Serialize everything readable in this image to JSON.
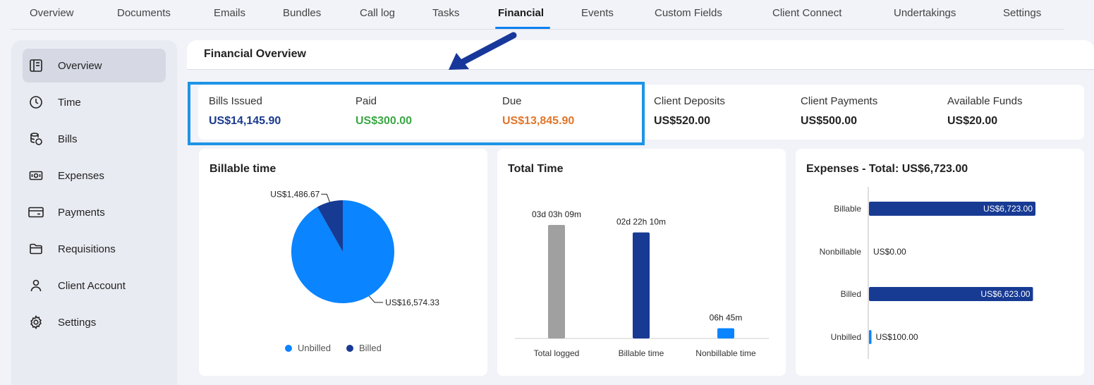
{
  "tabs": [
    {
      "label": "Overview"
    },
    {
      "label": "Documents"
    },
    {
      "label": "Emails"
    },
    {
      "label": "Bundles"
    },
    {
      "label": "Call log"
    },
    {
      "label": "Tasks"
    },
    {
      "label": "Financial",
      "active": true
    },
    {
      "label": "Events"
    },
    {
      "label": "Custom Fields"
    },
    {
      "label": "Client Connect"
    },
    {
      "label": "Undertakings"
    },
    {
      "label": "Settings"
    }
  ],
  "sidebar": {
    "items": [
      {
        "label": "Overview",
        "icon": "book-icon",
        "active": true
      },
      {
        "label": "Time",
        "icon": "clock-icon"
      },
      {
        "label": "Bills",
        "icon": "coins-icon"
      },
      {
        "label": "Expenses",
        "icon": "banknote-icon"
      },
      {
        "label": "Payments",
        "icon": "credit-card-icon"
      },
      {
        "label": "Requisitions",
        "icon": "folder-icon"
      },
      {
        "label": "Client Account",
        "icon": "user-icon"
      },
      {
        "label": "Settings",
        "icon": "gear-icon"
      }
    ]
  },
  "main": {
    "title": "Financial Overview",
    "stats": [
      {
        "label": "Bills Issued",
        "value": "US$14,145.90",
        "color": "#1a3a8f"
      },
      {
        "label": "Paid",
        "value": "US$300.00",
        "color": "#3aa845"
      },
      {
        "label": "Due",
        "value": "US$13,845.90",
        "color": "#e0762a"
      },
      {
        "label": "Client Deposits",
        "value": "US$520.00",
        "color": "#222222"
      },
      {
        "label": "Client Payments",
        "value": "US$500.00",
        "color": "#222222"
      },
      {
        "label": "Available Funds",
        "value": "US$20.00",
        "color": "#222222"
      }
    ]
  },
  "colors": {
    "light_blue": "#0a84ff",
    "dark_blue": "#173a93",
    "gray": "#a0a0a0",
    "highlight": "#1e94e6",
    "arrow": "#17389a"
  },
  "chart_data": [
    {
      "type": "pie",
      "title": "Billable time",
      "slices": [
        {
          "name": "Unbilled",
          "value": 16574.33,
          "label": "US$16,574.33"
        },
        {
          "name": "Billed",
          "value": 1486.67,
          "label": "US$1,486.67"
        }
      ],
      "legend": [
        "Unbilled",
        "Billed"
      ],
      "legend_position": "bottom"
    },
    {
      "type": "bar",
      "title": "Total Time",
      "categories": [
        "Total logged",
        "Billable time",
        "Nonbillable time"
      ],
      "values": [
        4509,
        4210,
        405
      ],
      "value_unit": "minutes",
      "data_labels": [
        "03d 03h 09m",
        "02d 22h 10m",
        "06h 45m"
      ]
    },
    {
      "type": "bar",
      "orientation": "horizontal",
      "title": "Expenses - Total: US$6,723.00",
      "categories": [
        "Billable",
        "Nonbillable",
        "Billed",
        "Unbilled"
      ],
      "values": [
        6723.0,
        0.0,
        6623.0,
        100.0
      ],
      "data_labels": [
        "US$6,723.00",
        "US$0.00",
        "US$6,623.00",
        "US$100.00"
      ]
    }
  ]
}
